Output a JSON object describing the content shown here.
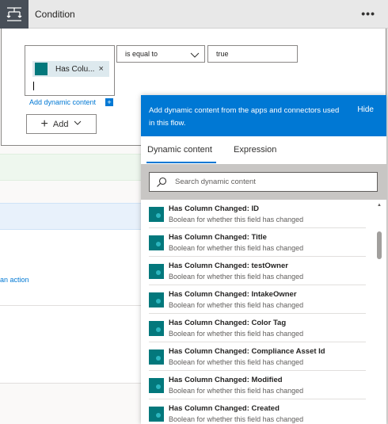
{
  "header": {
    "title": "Condition",
    "more_label": "•••"
  },
  "condition": {
    "token_label": "Has Colu...",
    "token_remove": "×",
    "add_dynamic_link": "Add dynamic content",
    "add_dynamic_plus": "+",
    "operator": "is equal to",
    "value": "true",
    "add_button_label": "Add"
  },
  "background": {
    "an_action_link": "an action"
  },
  "panel": {
    "message": "Add dynamic content from the apps and connectors used in this flow.",
    "hide_label": "Hide",
    "tabs": [
      "Dynamic content",
      "Expression"
    ],
    "search_placeholder": "Search dynamic content",
    "items": [
      {
        "title": "Has Column Changed: ID",
        "desc": "Boolean for whether this field has changed"
      },
      {
        "title": "Has Column Changed: Title",
        "desc": "Boolean for whether this field has changed"
      },
      {
        "title": "Has Column Changed: testOwner",
        "desc": "Boolean for whether this field has changed"
      },
      {
        "title": "Has Column Changed: IntakeOwner",
        "desc": "Boolean for whether this field has changed"
      },
      {
        "title": "Has Column Changed: Color Tag",
        "desc": "Boolean for whether this field has changed"
      },
      {
        "title": "Has Column Changed: Compliance Asset Id",
        "desc": "Boolean for whether this field has changed"
      },
      {
        "title": "Has Column Changed: Modified",
        "desc": "Boolean for whether this field has changed"
      },
      {
        "title": "Has Column Changed: Created",
        "desc": "Boolean for whether this field has changed"
      }
    ]
  },
  "colors": {
    "accent": "#0078d4",
    "sharepoint": "#03787c",
    "token_bg": "#dde9ee"
  },
  "icons": [
    "condition-icon",
    "more-icon",
    "chevron-down-icon",
    "plus-icon",
    "search-icon",
    "sharepoint-icon",
    "scroll-up-icon"
  ]
}
